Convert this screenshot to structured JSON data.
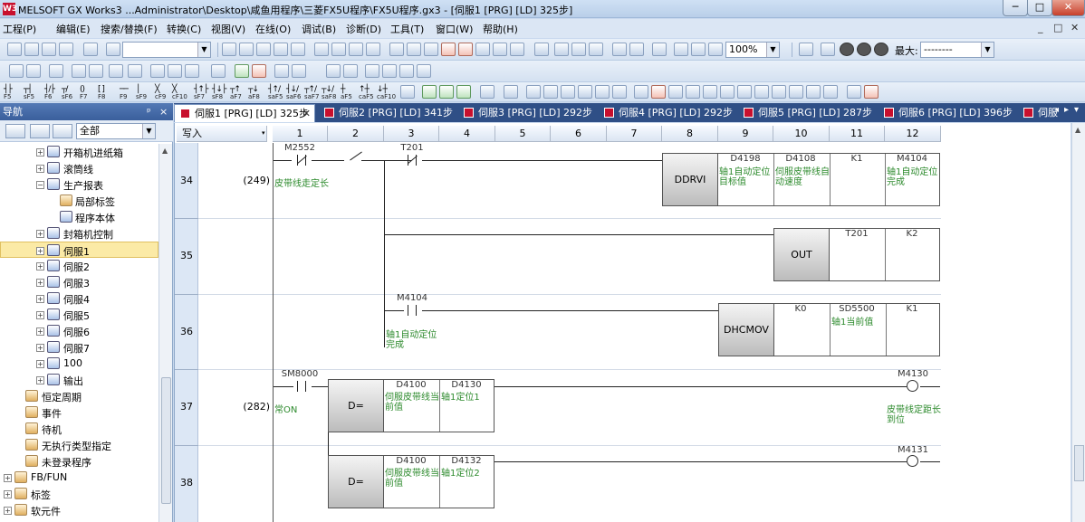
{
  "window": {
    "title": "MELSOFT GX Works3 ...Administrator\\Desktop\\咸鱼用程序\\三菱FX5U程序\\FX5U程序.gx3 - [伺服1 [PRG] [LD] 325步]",
    "icon_text": "W3",
    "minimize": "─",
    "maximize": "□",
    "close": "✕"
  },
  "menu": {
    "items": [
      "工程(P)",
      "编辑(E)",
      "搜索/替换(F)",
      "转换(C)",
      "视图(V)",
      "在线(O)",
      "调试(B)",
      "诊断(D)",
      "工具(T)",
      "窗口(W)",
      "帮助(H)"
    ],
    "mdi_controls": [
      "_",
      "□",
      "✕"
    ]
  },
  "toolbar": {
    "zoom": "100%",
    "max_label": "最大:",
    "max_value": "--------"
  },
  "ladder_symbols": {
    "labels": [
      "F5",
      "sF5",
      "F6",
      "sF6",
      "F7",
      "F8",
      "F9",
      "sF9",
      "cF9",
      "cF10",
      "sF7",
      "sF8",
      "aF7",
      "aF8",
      "saF5",
      "saF6",
      "saF7",
      "saF8",
      "aF5",
      "caF5",
      "caF10"
    ]
  },
  "navigation": {
    "title": "导航",
    "pin": "ᵖ",
    "close": "×",
    "filter": "全部",
    "tree": [
      {
        "label": "开箱机进纸箱",
        "expander": "+"
      },
      {
        "label": "滚筒线",
        "expander": "+"
      },
      {
        "label": "生产报表",
        "expander": "−"
      },
      {
        "label": "局部标签",
        "expander": ""
      },
      {
        "label": "程序本体",
        "expander": ""
      },
      {
        "label": "封箱机控制",
        "expander": "+"
      },
      {
        "label": "伺服1",
        "expander": "+"
      },
      {
        "label": "伺服2",
        "expander": "+"
      },
      {
        "label": "伺服3",
        "expander": "+"
      },
      {
        "label": "伺服4",
        "expander": "+"
      },
      {
        "label": "伺服5",
        "expander": "+"
      },
      {
        "label": "伺服6",
        "expander": "+"
      },
      {
        "label": "伺服7",
        "expander": "+"
      },
      {
        "label": "100",
        "expander": "+"
      },
      {
        "label": "输出",
        "expander": "+"
      },
      {
        "label": "恒定周期",
        "expander": ""
      },
      {
        "label": "事件",
        "expander": ""
      },
      {
        "label": "待机",
        "expander": ""
      },
      {
        "label": "无执行类型指定",
        "expander": ""
      },
      {
        "label": "未登录程序",
        "expander": ""
      },
      {
        "label": "FB/FUN",
        "expander": "+"
      },
      {
        "label": "标签",
        "expander": "+"
      },
      {
        "label": "软元件",
        "expander": "+"
      }
    ]
  },
  "tabs": [
    {
      "label": "伺服1 [PRG] [LD] 325步",
      "close": "✕"
    },
    {
      "label": "伺服2 [PRG] [LD] 341步"
    },
    {
      "label": "伺服3 [PRG] [LD] 292步"
    },
    {
      "label": "伺服4 [PRG] [LD] 292步"
    },
    {
      "label": "伺服5 [PRG] [LD] 287步"
    },
    {
      "label": "伺服6 [PRG] [LD] 396步"
    },
    {
      "label": "伺服"
    }
  ],
  "tab_nav": [
    "◂",
    "▸",
    "▾"
  ],
  "editor": {
    "mode": "写入",
    "mode_arrow": "▾",
    "columns": [
      "1",
      "2",
      "3",
      "4",
      "5",
      "6",
      "7",
      "8",
      "9",
      "10",
      "11",
      "12"
    ],
    "row_numbers": [
      "34",
      "35",
      "36",
      "37",
      "38"
    ],
    "step_numbers": [
      "(249)",
      "(282)"
    ],
    "rows": {
      "r34": {
        "contact1": "M2552",
        "contact1_comment": "皮带线走定长",
        "contact3": "T201",
        "instruction": "DDRVI",
        "args": [
          {
            "device": "D4198",
            "comment": "轴1自动定位目标值"
          },
          {
            "device": "D4108",
            "comment": "伺服皮带线自动速度"
          },
          {
            "device": "K1",
            "comment": ""
          },
          {
            "device": "M4104",
            "comment": "轴1自动定位完成"
          }
        ]
      },
      "r35": {
        "instruction": "OUT",
        "args": [
          {
            "device": "T201"
          },
          {
            "device": "K2"
          }
        ]
      },
      "r36": {
        "contact": "M4104",
        "contact_comment": "轴1自动定位完成",
        "instruction": "DHCMOV",
        "args": [
          {
            "device": "K0",
            "comment": ""
          },
          {
            "device": "SD5500",
            "comment": "轴1当前值"
          },
          {
            "device": "K1",
            "comment": ""
          }
        ]
      },
      "r37": {
        "contact": "SM8000",
        "contact_comment": "常ON",
        "instruction": "D=",
        "args": [
          {
            "device": "D4100",
            "comment": "伺服皮带线当前值"
          },
          {
            "device": "D4130",
            "comment": "轴1定位1"
          }
        ],
        "coil": "M4130",
        "coil_comment": "皮带线定距长到位"
      },
      "r38": {
        "instruction": "D=",
        "args": [
          {
            "device": "D4100",
            "comment": "伺服皮带线当前值"
          },
          {
            "device": "D4132",
            "comment": "轴1定位2"
          }
        ],
        "coil": "M4131"
      }
    }
  },
  "colors": {
    "comment_green": "#2c8a2c",
    "tab_bar": "#2f4f86",
    "selection": "#fbeaa6"
  }
}
